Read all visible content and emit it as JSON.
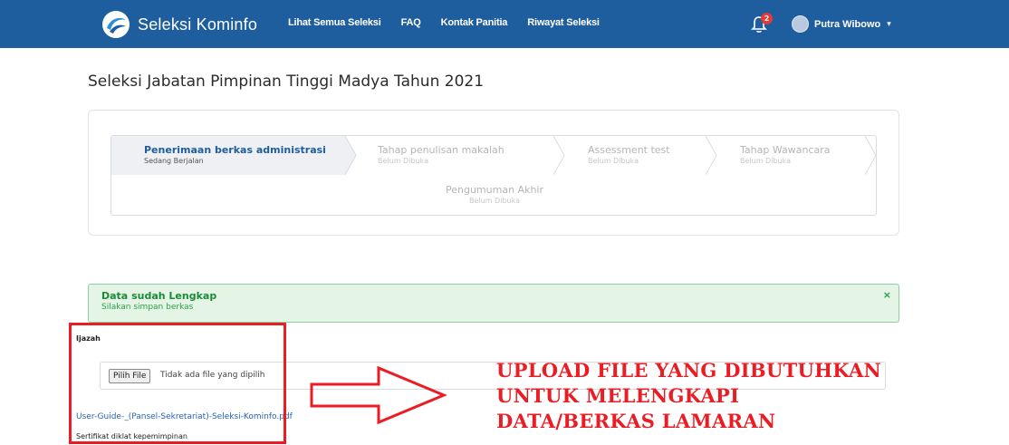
{
  "navbar": {
    "brand": "Seleksi Kominfo",
    "links": [
      "Lihat Semua Seleksi",
      "FAQ",
      "Kontak Panitia",
      "Riwayat Seleksi"
    ],
    "notification_count": "2",
    "user_name": "Putra Wibowo",
    "bg_color": "#1e5e9e"
  },
  "page": {
    "title": "Seleksi Jabatan Pimpinan Tinggi Madya Tahun 2021"
  },
  "stages": [
    {
      "title": "Penerimaan berkas administrasi",
      "status": "Sedang Berjalan",
      "active": true
    },
    {
      "title": "Tahap penulisan makalah",
      "status": "Belum Dibuka",
      "active": false
    },
    {
      "title": "Assessment test",
      "status": "Belum Dibuka",
      "active": false
    },
    {
      "title": "Tahap Wawancara",
      "status": "Belum Dibuka",
      "active": false
    },
    {
      "title": "Pengumuman Akhir",
      "status": "Belum Dibuka",
      "active": false
    }
  ],
  "alert": {
    "title": "Data sudah Lengkap",
    "message": "Silakan simpan berkas",
    "close_symbol": "×"
  },
  "form": {
    "ijazah_label": "Ijazah",
    "file_button": "Pilih File",
    "file_status": "Tidak ada file yang dipilih",
    "file_link": "User-Guide-_(Pansel-Sekretariat)-Seleksi-Kominfo.pdf",
    "next_label": "Sertifikat diklat kepemimpinan"
  },
  "annotation": {
    "lines": [
      "UPLOAD FILE YANG DIBUTUHKAN",
      "UNTUK MELENGKAPI",
      "DATA/BERKAS LAMARAN"
    ],
    "color": "#ea1c24"
  }
}
